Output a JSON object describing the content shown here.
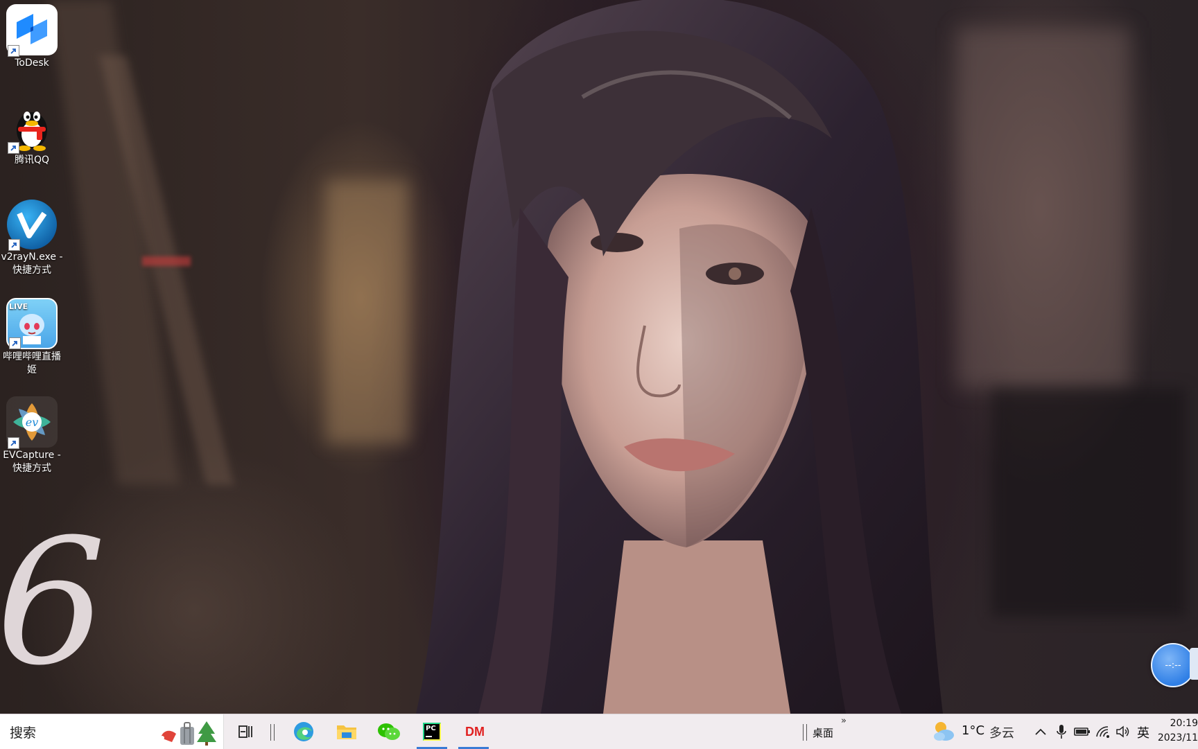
{
  "desktop": {
    "wallpaper_number": "6",
    "icons": [
      {
        "label": "ToDesk",
        "icon": "todesk-icon"
      },
      {
        "label": "腾讯QQ",
        "icon": "qq-penguin-icon"
      },
      {
        "label": "v2rayN.exe - 快捷方式",
        "icon": "v2rayn-icon"
      },
      {
        "label": "哔哩哔哩直播姬",
        "icon": "bilibili-live-icon",
        "badge": "LIVE"
      },
      {
        "label": "EVCapture - 快捷方式",
        "icon": "evcapture-icon",
        "badge": "ev"
      }
    ]
  },
  "floating_widget": {
    "text": "--:--"
  },
  "taskbar": {
    "search_placeholder": "搜索",
    "pinned": [
      "task-view-icon",
      "edge-icon",
      "file-explorer-icon",
      "wechat-icon",
      "pycharm-icon",
      "dm-icon"
    ],
    "pycharm_label": "PC",
    "dm_label": "DM",
    "desktop_toolbar_label": "桌面",
    "toolbar_expand": "»",
    "weather": {
      "temp": "1°C",
      "condition": "多云"
    },
    "ime": "英",
    "clock": {
      "time": "20:19",
      "date": "2023/11"
    }
  },
  "colors": {
    "accent": "#3a7bd5",
    "dm_red": "#e02020",
    "taskbar_bg": "#f1ecef"
  }
}
